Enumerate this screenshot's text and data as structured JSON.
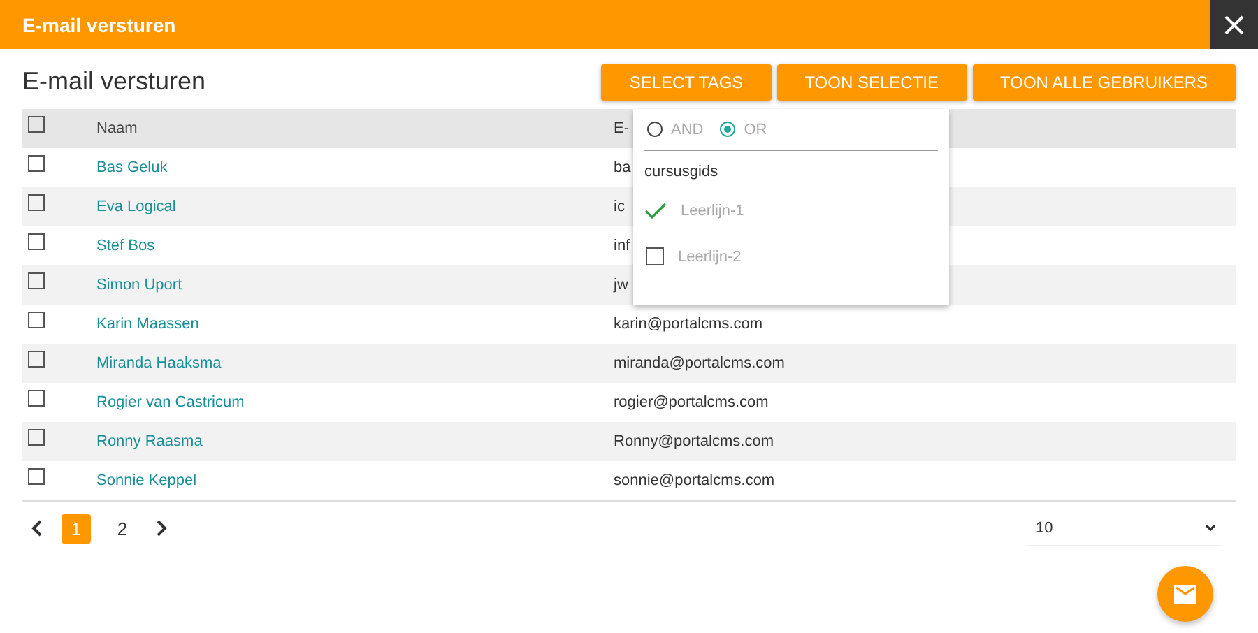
{
  "window": {
    "title": "E-mail versturen"
  },
  "heading": "E-mail versturen",
  "buttons": [
    "SELECT TAGS",
    "TOON SELECTIE",
    "TOON ALLE GEBRUIKERS"
  ],
  "table": {
    "header_checked": false,
    "columns": [
      "Naam",
      "E-"
    ],
    "rows": [
      {
        "checked": false,
        "name": "Bas Geluk",
        "email": "ba"
      },
      {
        "checked": false,
        "name": "Eva Logical",
        "email": "ic"
      },
      {
        "checked": false,
        "name": "Stef Bos",
        "email": "inf"
      },
      {
        "checked": false,
        "name": "Simon Uport",
        "email": "jw"
      },
      {
        "checked": false,
        "name": "Karin Maassen",
        "email": "karin@portalcms.com"
      },
      {
        "checked": false,
        "name": "Miranda Haaksma",
        "email": "miranda@portalcms.com"
      },
      {
        "checked": false,
        "name": "Rogier van Castricum",
        "email": "rogier@portalcms.com"
      },
      {
        "checked": false,
        "name": "Ronny Raasma",
        "email": "Ronny@portalcms.com"
      },
      {
        "checked": false,
        "name": "Sonnie Keppel",
        "email": "sonnie@portalcms.com"
      }
    ]
  },
  "tag_menu": {
    "modes": [
      {
        "label": "AND",
        "selected": false
      },
      {
        "label": "OR",
        "selected": true
      }
    ],
    "group": "cursusgids",
    "tags": [
      {
        "label": "Leerlijn-1",
        "checked": true
      },
      {
        "label": "Leerlijn-2",
        "checked": false
      }
    ]
  },
  "pagination": {
    "pages": [
      {
        "label": "1",
        "selected": true
      },
      {
        "label": "2",
        "selected": false
      }
    ]
  },
  "page_size": "10"
}
